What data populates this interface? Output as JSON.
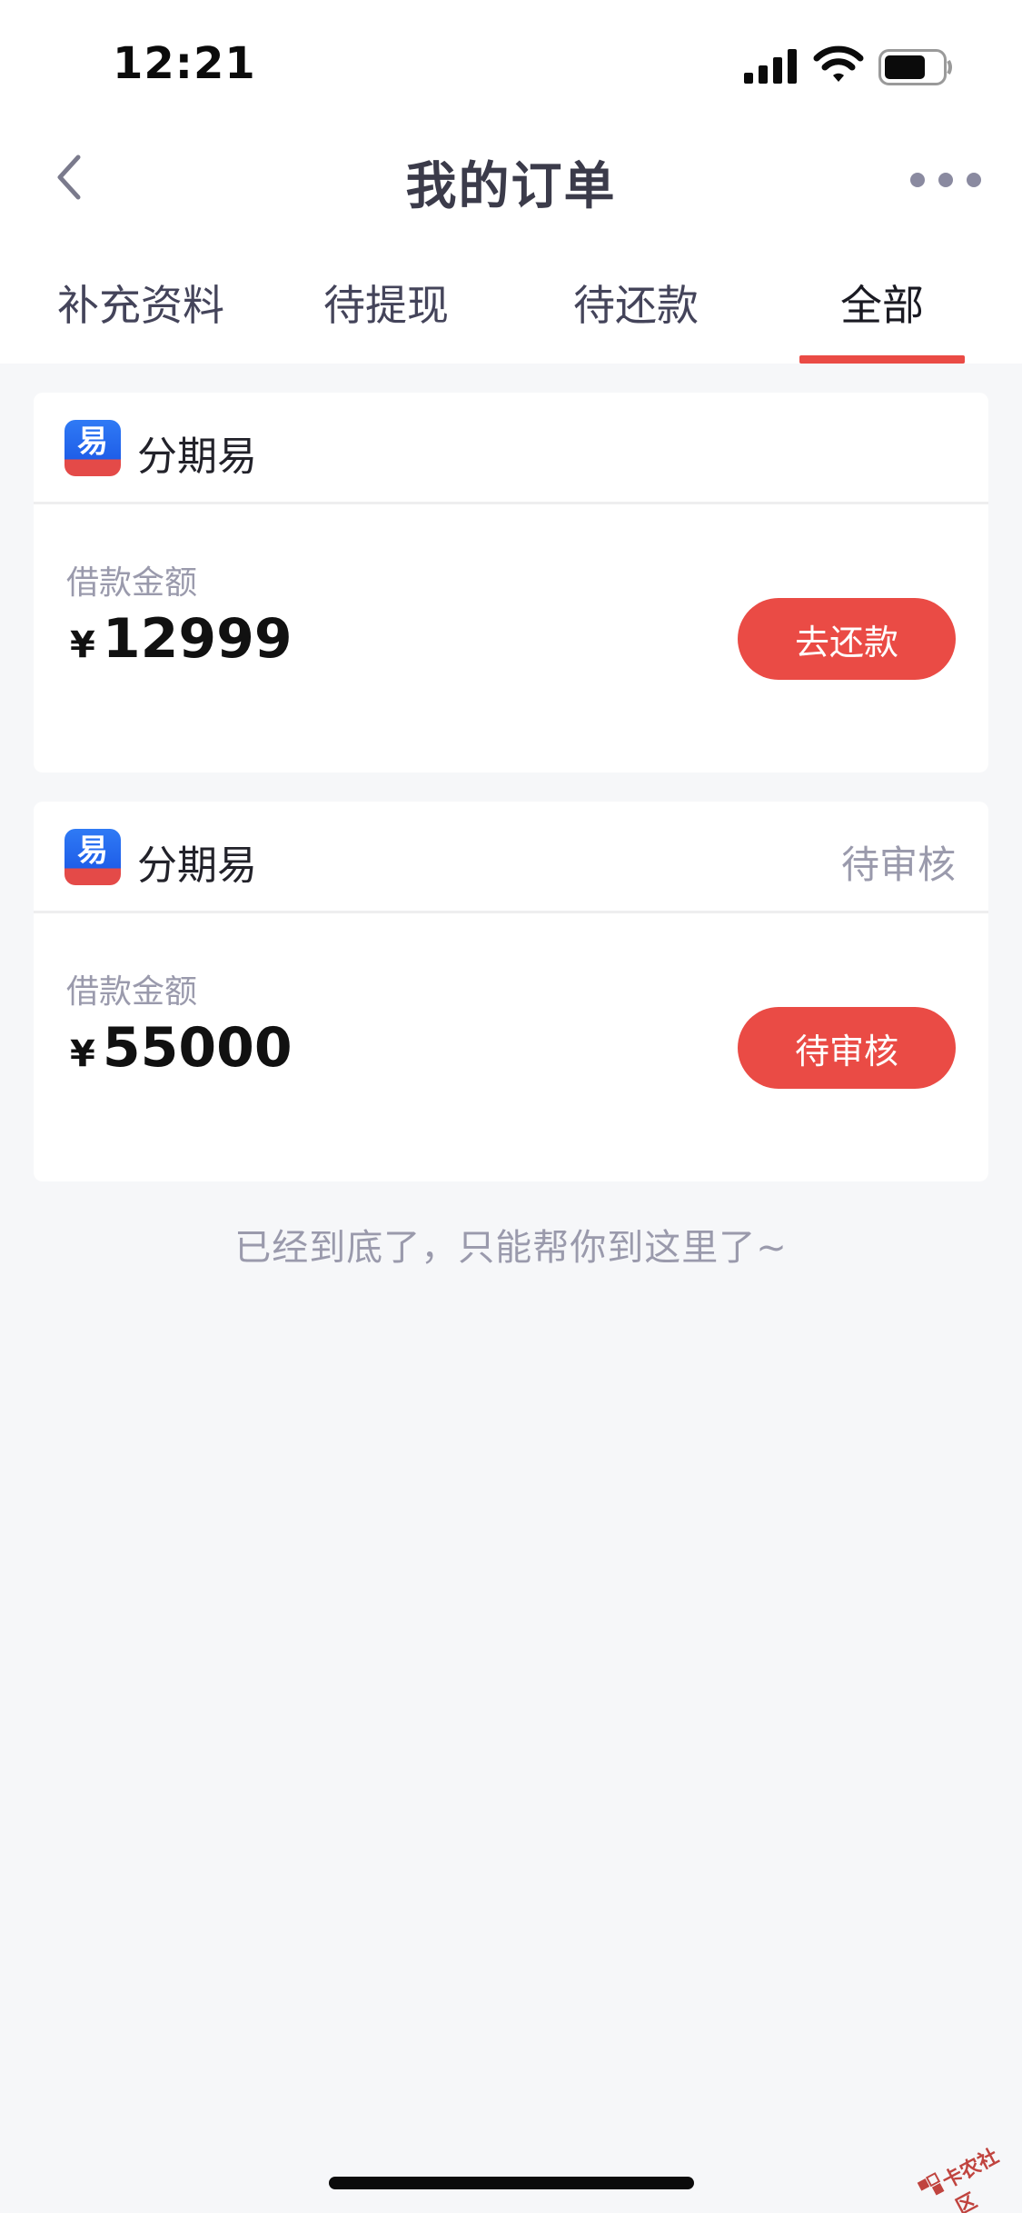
{
  "status_bar": {
    "time": "12:21",
    "icons": [
      "signal-icon",
      "wifi-icon",
      "battery-icon"
    ]
  },
  "nav": {
    "title": "我的订单",
    "back_icon": "chevron-left-icon",
    "more_icon": "more-dots-icon"
  },
  "tabs": [
    {
      "label": "补充资料",
      "active": false
    },
    {
      "label": "待提现",
      "active": false
    },
    {
      "label": "待还款",
      "active": false
    },
    {
      "label": "全部",
      "active": true
    }
  ],
  "orders": [
    {
      "brand": "分期易",
      "status": "",
      "amount_label": "借款金额",
      "currency": "¥",
      "amount": "12999",
      "action": "去还款"
    },
    {
      "brand": "分期易",
      "status": "待审核",
      "amount_label": "借款金额",
      "currency": "¥",
      "amount": "55000",
      "action": "待审核"
    }
  ],
  "footer": {
    "end_text": "已经到底了，只能帮你到这里了~"
  },
  "watermark": {
    "text": "卡农社区"
  },
  "colors": {
    "accent": "#ea4b45",
    "background": "#f6f7f9",
    "muted_text": "#9a9aac"
  }
}
